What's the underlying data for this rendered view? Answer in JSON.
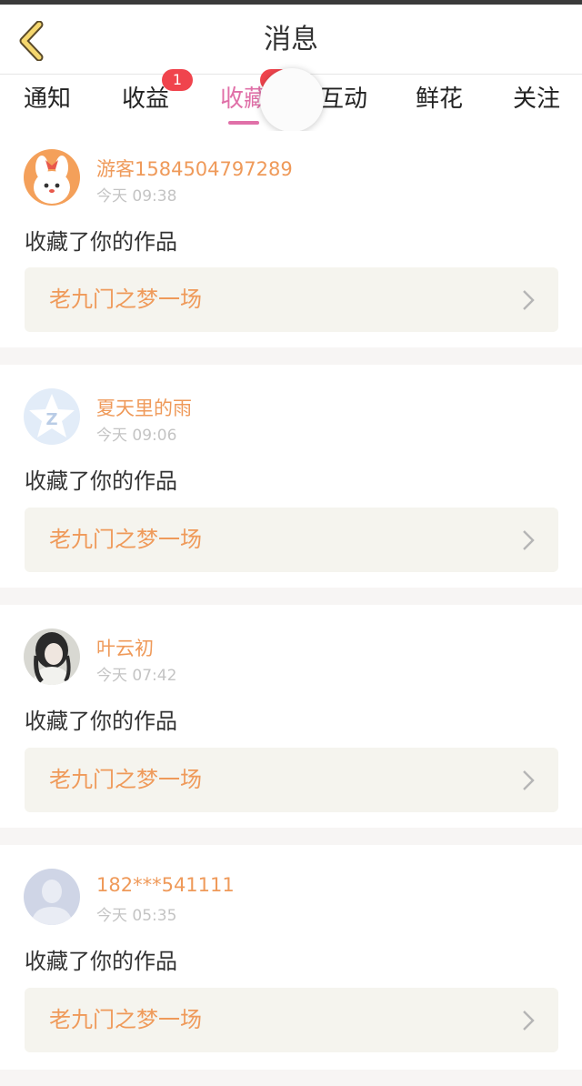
{
  "header": {
    "title": "消息",
    "back_icon": "chevron-left-icon"
  },
  "tabs": [
    {
      "label": "通知"
    },
    {
      "label": "收益",
      "badge": "1"
    },
    {
      "label": "收藏",
      "active": true
    },
    {
      "label": "互动"
    },
    {
      "label": "鲜花"
    },
    {
      "label": "关注"
    }
  ],
  "colors": {
    "accent": "#e070a8",
    "name": "#ef9a5a",
    "badge": "#f0444d"
  },
  "messages": [
    {
      "user": "游客1584504797289",
      "time": "今天 09:38",
      "action": "收藏了你的作品",
      "work": "老九门之梦一场",
      "avatar": "bunny-avatar"
    },
    {
      "user": "夏天里的雨",
      "time": "今天 09:06",
      "action": "收藏了你的作品",
      "work": "老九门之梦一场",
      "avatar": "qq-star-avatar"
    },
    {
      "user": "叶云初",
      "time": "今天 07:42",
      "action": "收藏了你的作品",
      "work": "老九门之梦一场",
      "avatar": "girl-avatar"
    },
    {
      "user": "182***541111",
      "time": "今天 05:35",
      "action": "收藏了你的作品",
      "work": "老九门之梦一场",
      "avatar": "default-person-avatar"
    }
  ]
}
